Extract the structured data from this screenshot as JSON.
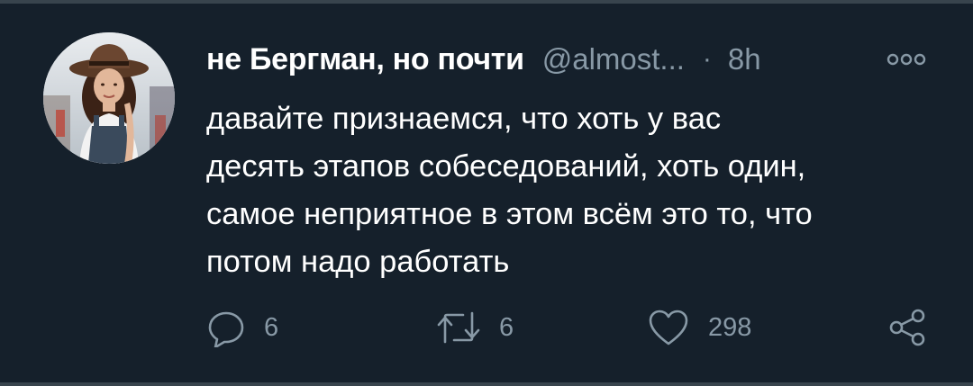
{
  "tweet": {
    "author": {
      "display_name": "не Бергман, но почти",
      "handle": "@almost...",
      "separator": "·",
      "time": "8h"
    },
    "text_lines": [
      "давайте признаемся, что хоть у вас",
      "десять этапов собеседований, хоть один,",
      "самое неприятное в этом всём это то, что",
      "потом надо работать"
    ],
    "actions": {
      "reply_count": "6",
      "retweet_count": "6",
      "like_count": "298"
    }
  },
  "icons": {
    "more": "more-horizontal-icon",
    "reply": "reply-icon",
    "retweet": "retweet-icon",
    "like": "heart-icon",
    "share": "share-icon"
  },
  "colors": {
    "background": "#15202b",
    "text_primary": "#ffffff",
    "text_secondary": "#8899a6",
    "divider": "#38444d"
  }
}
